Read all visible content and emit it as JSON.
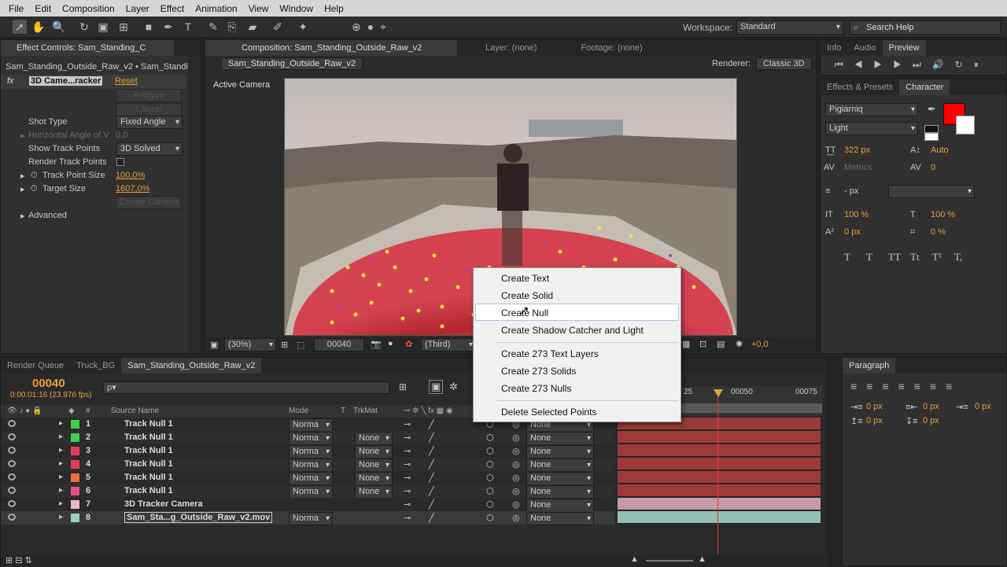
{
  "menu": [
    "File",
    "Edit",
    "Composition",
    "Layer",
    "Effect",
    "Animation",
    "View",
    "Window",
    "Help"
  ],
  "workspace": {
    "label": "Workspace:",
    "value": "Standard"
  },
  "search": {
    "placeholder": "Search Help"
  },
  "effect_controls": {
    "tab": "Effect Controls: Sam_Standing_C",
    "subtitle": "Sam_Standing_Outside_Raw_v2 • Sam_Standing",
    "effect_name": "3D Came...racker",
    "reset": "Reset",
    "analyze": "Analyze",
    "cancel": "Cancel",
    "shot_type_label": "Shot Type",
    "shot_type_value": "Fixed Angle",
    "hangle_label": "Horizontal Angle of V",
    "hangle_value": "0,0",
    "show_track_label": "Show Track Points",
    "show_track_value": "3D Solved",
    "render_track_label": "Render Track Points",
    "track_size_label": "Track Point Size",
    "track_size_value": "100,0%",
    "target_size_label": "Target Size",
    "target_size_value": "1607,0%",
    "create_camera": "Create Camera",
    "advanced": "Advanced"
  },
  "composition": {
    "tab": "Composition: Sam_Standing_Outside_Raw_v2",
    "layer_tab": "Layer: (none)",
    "footage_tab": "Footage: (none)",
    "comp_tab": "Sam_Standing_Outside_Raw_v2",
    "renderer_label": "Renderer:",
    "renderer_value": "Classic 3D",
    "active_camera": "Active Camera",
    "zoom": "(30%)",
    "frame": "00040",
    "resolution": "(Third)",
    "exposure": "+0,0"
  },
  "context_menu": {
    "items": [
      "Create Text",
      "Create Solid",
      "Create Null",
      "Create Shadow Catcher and Light",
      "Create 273 Text Layers",
      "Create 273 Solids",
      "Create 273 Nulls",
      "Delete Selected Points"
    ],
    "highlighted": "Create Null"
  },
  "right_panels": {
    "tabs_top": [
      "Info",
      "Audio",
      "Preview"
    ],
    "tabs_char": [
      "Effects & Presets",
      "Character"
    ],
    "font": "Pigiarniq",
    "style": "Light",
    "font_size": "322 px",
    "leading": "Auto",
    "kerning": "Metrics",
    "tracking": "0",
    "stroke": "- px",
    "vscale": "100 %",
    "hscale": "100 %",
    "baseline": "0 px",
    "tsume": "0 %",
    "fill_color": "#ff0000",
    "text_styles": [
      "T",
      "T",
      "TT",
      "Tt",
      "T¹",
      "T,"
    ],
    "paragraph_tab": "Paragraph",
    "indents": [
      "0 px",
      "0 px",
      "0 px",
      "0 px",
      "0 px"
    ]
  },
  "timeline": {
    "tabs": [
      "Render Queue",
      "Truck_BG",
      "Sam_Standing_Outside_Raw_v2"
    ],
    "timecode": "00040",
    "timecode_sub": "0:00:01:16 (23.976 fps)",
    "search_placeholder": "ρ▾",
    "headers": {
      "source": "Source Name",
      "mode": "Mode",
      "t": "T",
      "trkmat": "TrkMat",
      "parent": "Parent"
    },
    "ruler": [
      "25",
      "00050",
      "00075"
    ],
    "layers": [
      {
        "num": "1",
        "name": "Track Null 1",
        "color": "#3fcf4a",
        "mode": "Norma",
        "trk": "",
        "parent": "None",
        "bar": "#9c3a3a"
      },
      {
        "num": "2",
        "name": "Track Null 1",
        "color": "#3fcf4a",
        "mode": "Norma",
        "trk": "None",
        "parent": "None",
        "bar": "#9c3a3a"
      },
      {
        "num": "3",
        "name": "Track Null 1",
        "color": "#e53c5a",
        "mode": "Norma",
        "trk": "None",
        "parent": "None",
        "bar": "#9c3a3a"
      },
      {
        "num": "4",
        "name": "Track Null 1",
        "color": "#e53c5a",
        "mode": "Norma",
        "trk": "None",
        "parent": "None",
        "bar": "#9c3a3a"
      },
      {
        "num": "5",
        "name": "Track Null 1",
        "color": "#ef6b3a",
        "mode": "Norma",
        "trk": "None",
        "parent": "None",
        "bar": "#9c3a3a"
      },
      {
        "num": "6",
        "name": "Track Null 1",
        "color": "#e8508a",
        "mode": "Norma",
        "trk": "None",
        "parent": "None",
        "bar": "#9c3a3a"
      },
      {
        "num": "7",
        "name": "3D Tracker Camera",
        "color": "#e7b6c6",
        "mode": "",
        "trk": "",
        "parent": "None",
        "bar": "#c79aa8"
      },
      {
        "num": "8",
        "name": "Sam_Sta...g_Outside_Raw_v2.mov",
        "color": "#9ad0c6",
        "mode": "Norma",
        "trk": "",
        "parent": "None",
        "bar": "#8fc0b6"
      }
    ]
  }
}
